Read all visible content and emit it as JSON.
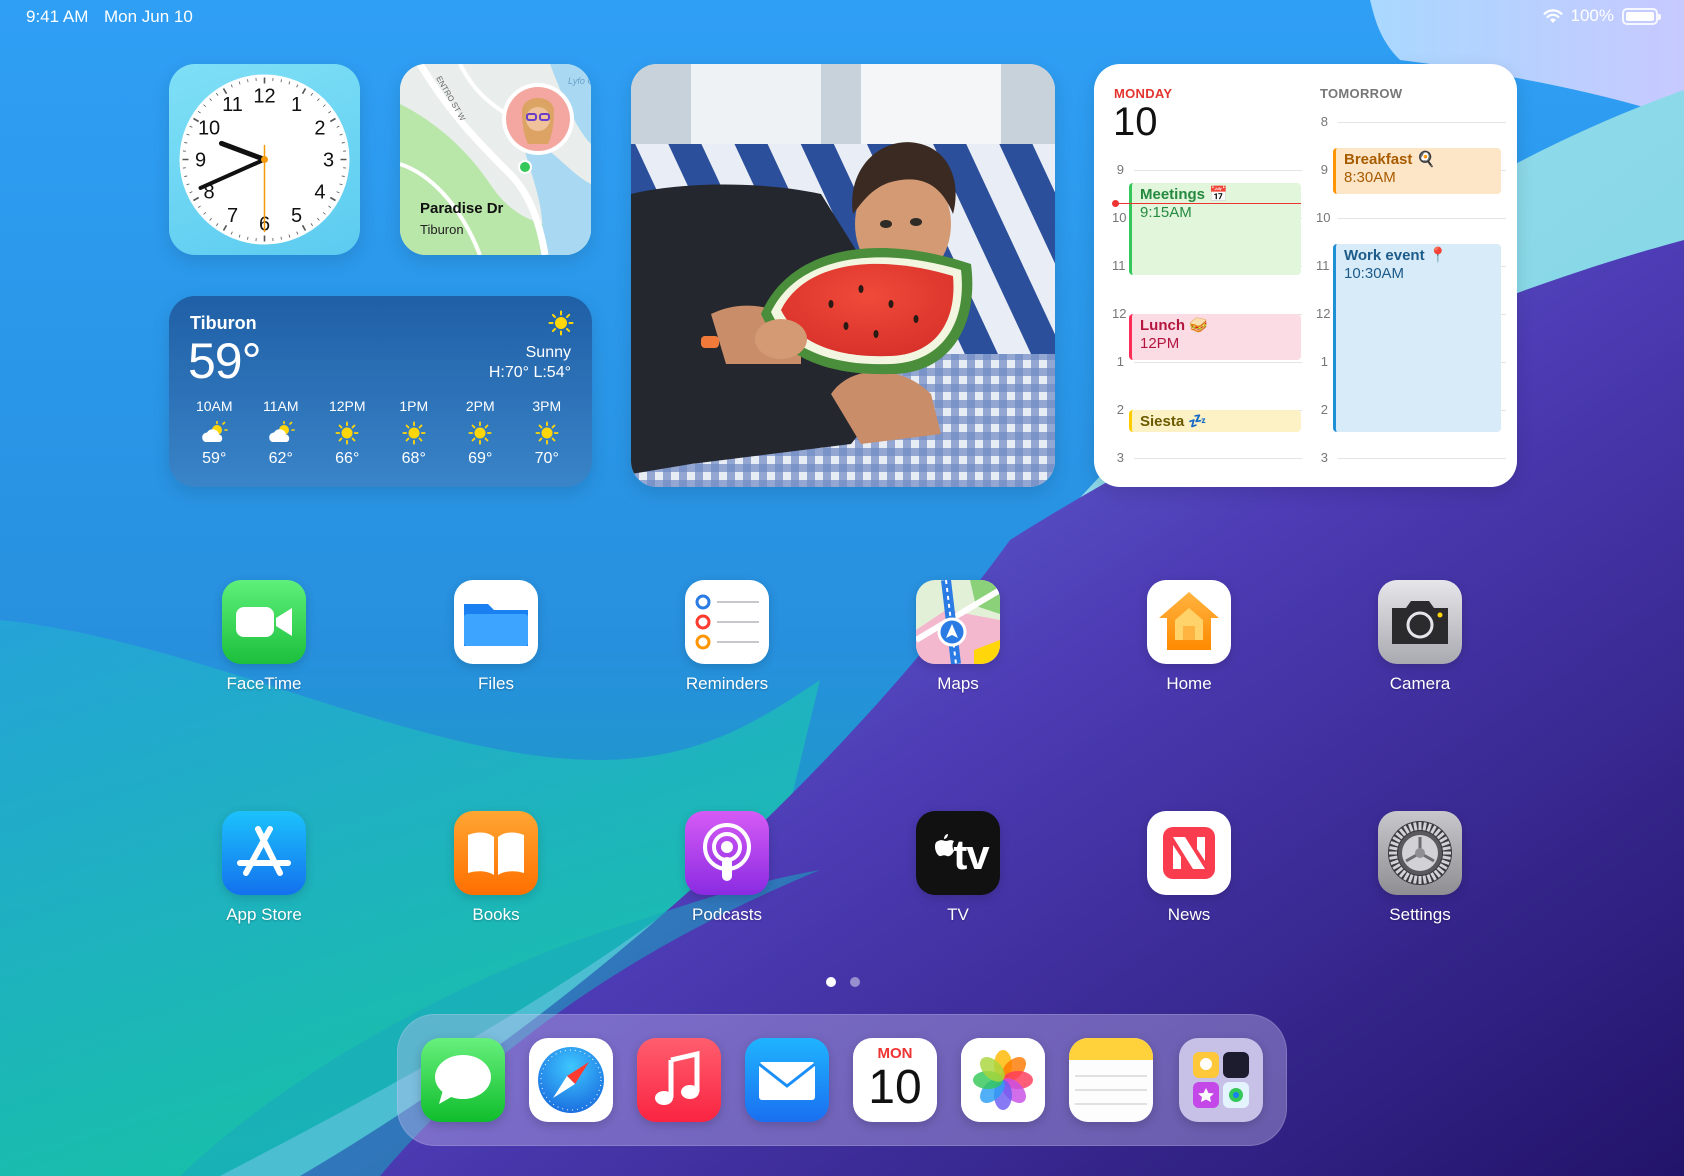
{
  "status_bar": {
    "time": "9:41 AM",
    "date": "Mon Jun 10",
    "battery_text": "100%",
    "battery_level": 1.0
  },
  "clock_widget": {
    "numbers": [
      "12",
      "1",
      "2",
      "3",
      "4",
      "5",
      "6",
      "7",
      "8",
      "9",
      "10",
      "11"
    ],
    "time_shown": "9:41"
  },
  "map_widget": {
    "place": "Paradise Dr",
    "city": "Tiburon",
    "street_labels": [
      "ENTRO ST W",
      "Lyfo Cov"
    ]
  },
  "weather_widget": {
    "city": "Tiburon",
    "temperature": "59°",
    "condition": "Sunny",
    "high_low": "H:70° L:54°",
    "hourly": [
      {
        "time": "10AM",
        "icon": "partly-sunny-icon",
        "temp": "59°"
      },
      {
        "time": "11AM",
        "icon": "partly-sunny-icon",
        "temp": "62°"
      },
      {
        "time": "12PM",
        "icon": "sun-icon",
        "temp": "66°"
      },
      {
        "time": "1PM",
        "icon": "sun-icon",
        "temp": "68°"
      },
      {
        "time": "2PM",
        "icon": "sun-icon",
        "temp": "69°"
      },
      {
        "time": "3PM",
        "icon": "sun-icon",
        "temp": "70°"
      }
    ]
  },
  "photo_widget": {
    "subject": "child-eating-watermelon-photo"
  },
  "calendar_widget": {
    "today_label": "MONDAY",
    "today_number": "10",
    "tomorrow_label": "TOMORROW",
    "today_hours": [
      "9",
      "10",
      "11",
      "12",
      "1",
      "2",
      "3"
    ],
    "tomorrow_hours": [
      "8",
      "9",
      "10",
      "11",
      "12",
      "1",
      "2",
      "3"
    ],
    "today_events": [
      {
        "title": "Meetings 📅",
        "time": "9:15AM"
      },
      {
        "title": "Lunch 🥪",
        "time": "12PM"
      },
      {
        "title": "Siesta 💤",
        "time": ""
      }
    ],
    "tomorrow_events": [
      {
        "title": "Breakfast 🍳",
        "time": "8:30AM"
      },
      {
        "title": "Work event 📍",
        "time": "10:30AM"
      }
    ]
  },
  "apps": {
    "row1": [
      "FaceTime",
      "Files",
      "Reminders",
      "Maps",
      "Home",
      "Camera"
    ],
    "row2": [
      "App Store",
      "Books",
      "Podcasts",
      "TV",
      "News",
      "Settings"
    ]
  },
  "tv_icon_text": "tv",
  "page_indicator": {
    "pages": 2,
    "current": 1
  },
  "dock": {
    "apps": [
      "Messages",
      "Safari",
      "Music",
      "Mail",
      "Calendar",
      "Photos",
      "Notes",
      "App Library"
    ],
    "calendar_month": "MON",
    "calendar_day": "10"
  },
  "colors": {
    "accent_red": "#e3342f",
    "calendar_green": "#34c759",
    "calendar_pink": "#ff2d55",
    "calendar_yellow": "#ffcc00",
    "calendar_orange": "#ff9500",
    "calendar_blue": "#1f8fd6"
  }
}
